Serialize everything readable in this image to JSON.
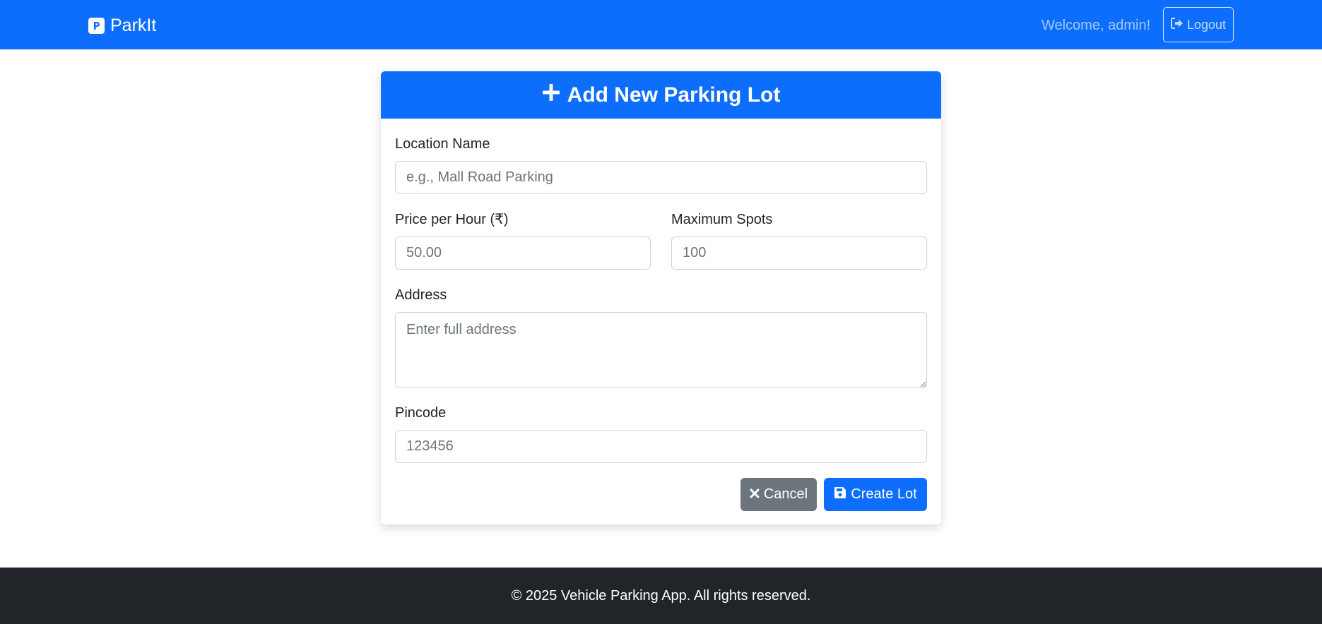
{
  "navbar": {
    "brand_name": "ParkIt",
    "brand_icon": "parking-icon",
    "welcome_text": "Welcome, admin!",
    "logout_label": "Logout",
    "logout_icon": "logout-icon",
    "bg_color": "#0d6efd"
  },
  "form": {
    "title": "Add New Parking Lot",
    "title_icon": "plus-icon",
    "location_name": {
      "label": "Location Name",
      "placeholder": "e.g., Mall Road Parking",
      "value": ""
    },
    "price_per_hour": {
      "label": "Price per Hour (₹)",
      "placeholder": "50.00",
      "value": ""
    },
    "maximum_spots": {
      "label": "Maximum Spots",
      "placeholder": "100",
      "value": ""
    },
    "address": {
      "label": "Address",
      "placeholder": "Enter full address",
      "value": ""
    },
    "pincode": {
      "label": "Pincode",
      "placeholder": "123456",
      "value": ""
    },
    "cancel_label": "Cancel",
    "cancel_icon": "close-icon",
    "create_label": "Create Lot",
    "create_icon": "save-icon"
  },
  "footer": {
    "text": "© 2025 Vehicle Parking App. All rights reserved."
  },
  "colors": {
    "primary": "#0d6efd",
    "secondary": "#6c757d",
    "dark": "#212529"
  }
}
